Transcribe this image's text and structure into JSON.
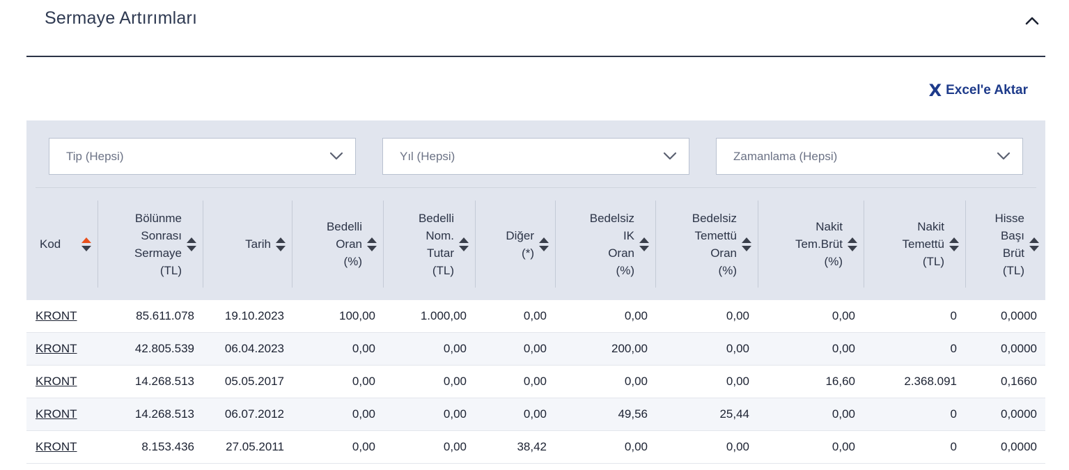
{
  "section": {
    "title": "Sermaye Artırımları",
    "collapse_icon": "chevron-up-icon"
  },
  "excel": {
    "icon_glyph": "X",
    "label": "Excel'e Aktar"
  },
  "filters": [
    {
      "name": "tip",
      "value": "Tip (Hepsi)"
    },
    {
      "name": "yil",
      "value": "Yıl (Hepsi)"
    },
    {
      "name": "zamanlama",
      "value": "Zamanlama (Hepsi)"
    }
  ],
  "colors": {
    "sort_active": "#e8501c",
    "sort_inactive": "#3a3f4b",
    "panel_bg": "#e1e5ee",
    "link": "#1d3a8a"
  },
  "columns": [
    {
      "key": "kod",
      "lines": [
        "Kod"
      ],
      "sort_active": true
    },
    {
      "key": "bolunme",
      "lines": [
        "Bölünme",
        "Sonrası",
        "Sermaye",
        "(TL)"
      ]
    },
    {
      "key": "tarih",
      "lines": [
        "Tarih"
      ]
    },
    {
      "key": "bedelli_oran",
      "lines": [
        "Bedelli",
        "Oran",
        "(%)"
      ]
    },
    {
      "key": "bedelli_nom",
      "lines": [
        "Bedelli",
        "Nom.",
        "Tutar",
        "(TL)"
      ]
    },
    {
      "key": "diger",
      "lines": [
        "Diğer",
        "(*)"
      ]
    },
    {
      "key": "bedelsiz_ik",
      "lines": [
        "Bedelsiz",
        "IK",
        "Oran",
        "(%)"
      ]
    },
    {
      "key": "bedelsiz_temettu",
      "lines": [
        "Bedelsiz",
        "Temettü",
        "Oran",
        "(%)"
      ]
    },
    {
      "key": "nakit_tem_brut",
      "lines": [
        "Nakit",
        "Tem.Brüt",
        "(%)"
      ]
    },
    {
      "key": "nakit_temettu",
      "lines": [
        "Nakit",
        "Temettü",
        "(TL)"
      ]
    },
    {
      "key": "hisse_basi",
      "lines": [
        "Hisse",
        "Başı",
        "Brüt",
        "(TL)"
      ]
    }
  ],
  "rows": [
    [
      "KRONT",
      "85.611.078",
      "19.10.2023",
      "100,00",
      "1.000,00",
      "0,00",
      "0,00",
      "0,00",
      "0,00",
      "0",
      "0,0000"
    ],
    [
      "KRONT",
      "42.805.539",
      "06.04.2023",
      "0,00",
      "0,00",
      "0,00",
      "200,00",
      "0,00",
      "0,00",
      "0",
      "0,0000"
    ],
    [
      "KRONT",
      "14.268.513",
      "05.05.2017",
      "0,00",
      "0,00",
      "0,00",
      "0,00",
      "0,00",
      "16,60",
      "2.368.091",
      "0,1660"
    ],
    [
      "KRONT",
      "14.268.513",
      "06.07.2012",
      "0,00",
      "0,00",
      "0,00",
      "49,56",
      "25,44",
      "0,00",
      "0",
      "0,0000"
    ],
    [
      "KRONT",
      "8.153.436",
      "27.05.2011",
      "0,00",
      "0,00",
      "38,42",
      "0,00",
      "0,00",
      "0,00",
      "0",
      "0,0000"
    ]
  ]
}
